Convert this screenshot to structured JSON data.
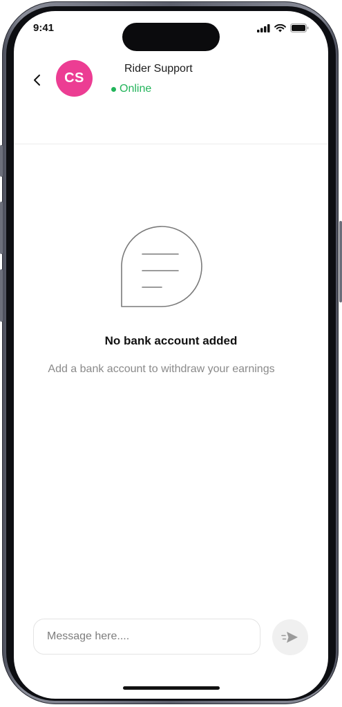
{
  "status_bar": {
    "time": "9:41"
  },
  "header": {
    "avatar_initials": "CS",
    "contact_name": "Rider Support",
    "status_text": "Online"
  },
  "empty_state": {
    "title": "No bank account added",
    "subtitle": "Add a bank account to withdraw your earnings"
  },
  "composer": {
    "placeholder": "Message here...."
  },
  "colors": {
    "avatar": "#ec3d93",
    "online": "#22b45a",
    "send_button_bg": "#f0f0f0"
  },
  "icons": {
    "back": "chevron-left-icon",
    "empty_state": "chat-bubble-icon",
    "send": "send-icon"
  }
}
